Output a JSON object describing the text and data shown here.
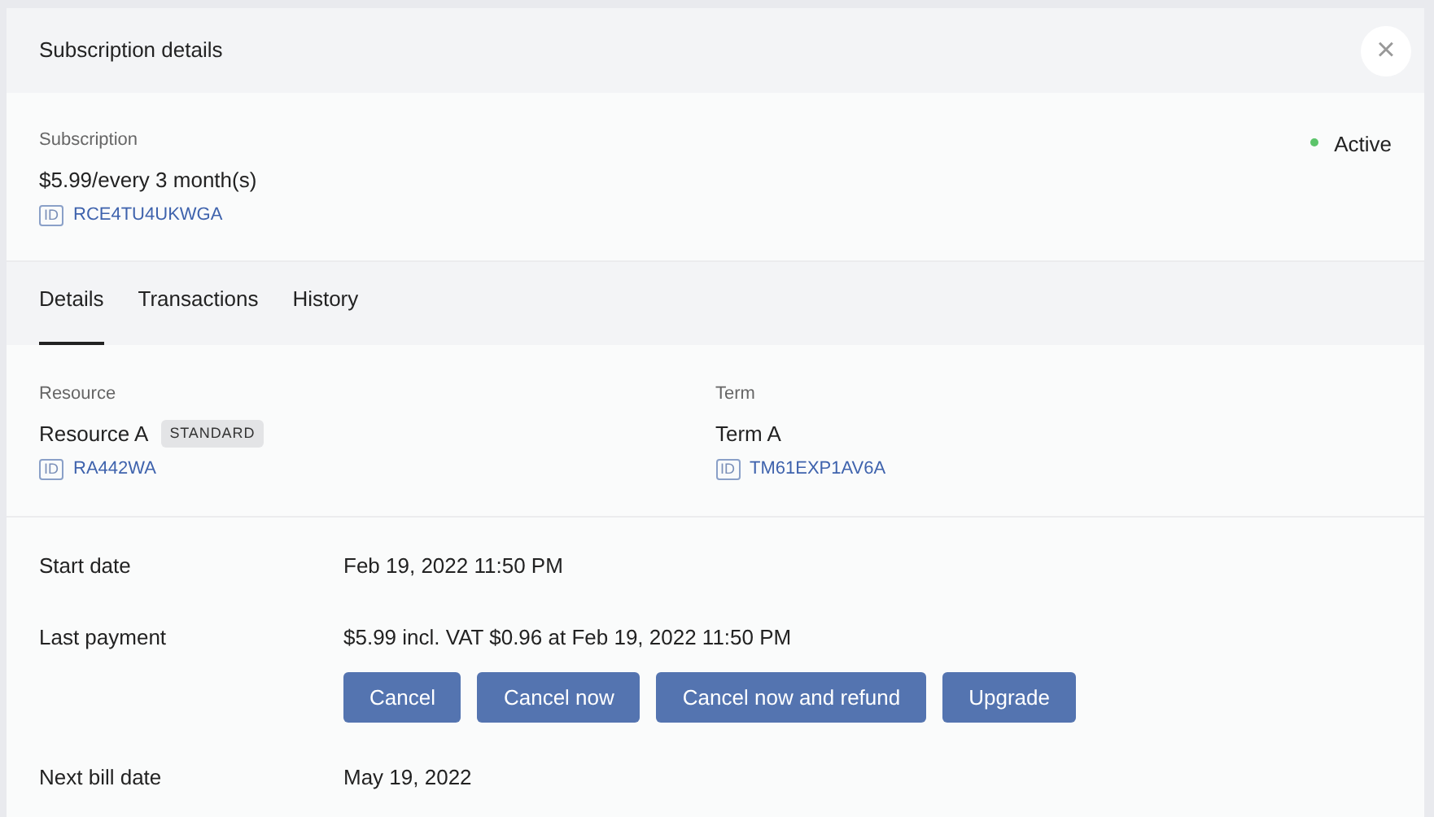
{
  "dialog": {
    "title": "Subscription details",
    "close": "×"
  },
  "subscription": {
    "label": "Subscription",
    "price": "$5.99/every 3 month(s)",
    "id_badge": "ID",
    "id": "RCE4TU4UKWGA",
    "status": {
      "text": "Active",
      "color": "#5cc46a"
    }
  },
  "tabs": [
    {
      "label": "Details",
      "selected": true
    },
    {
      "label": "Transactions",
      "selected": false
    },
    {
      "label": "History",
      "selected": false
    }
  ],
  "items": [
    {
      "label": "Resource",
      "name": "Resource A",
      "tag": "STANDARD",
      "id_badge": "ID",
      "id": "RA442WA"
    },
    {
      "label": "Term",
      "name": "Term A",
      "id_badge": "ID",
      "id": "TM61EXP1AV6A"
    }
  ],
  "rows": [
    {
      "label": "Start date",
      "value": "Feb 19, 2022 11:50 PM"
    },
    {
      "label": "Last payment",
      "value": "$5.99 incl. VAT $0.96 at Feb 19, 2022 11:50 PM",
      "buttons": [
        "Cancel",
        "Cancel now",
        "Cancel now and refund",
        "Upgrade"
      ]
    },
    {
      "label": "Next bill date",
      "value": "May 19, 2022"
    }
  ]
}
